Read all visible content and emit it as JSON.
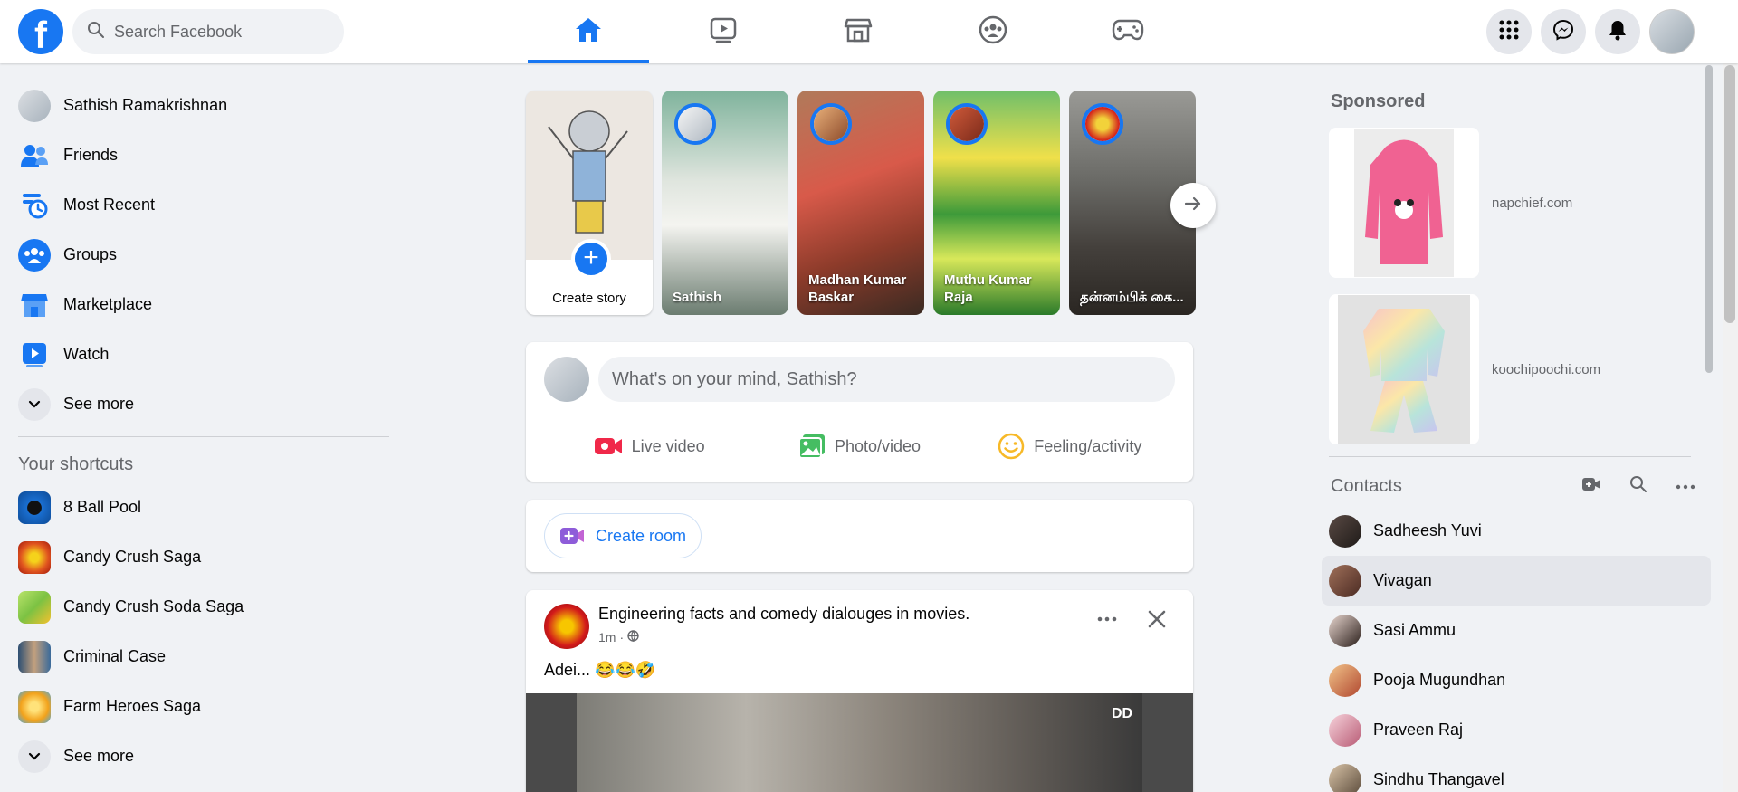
{
  "topbar": {
    "logo_text": "f",
    "search_placeholder": "Search Facebook",
    "tabs": [
      {
        "name": "home",
        "icon": "home-icon",
        "active": true
      },
      {
        "name": "watch",
        "icon": "video-icon",
        "active": false
      },
      {
        "name": "marketplace",
        "icon": "store-icon",
        "active": false
      },
      {
        "name": "groups",
        "icon": "groups-icon",
        "active": false
      },
      {
        "name": "gaming",
        "icon": "gamepad-icon",
        "active": false
      }
    ],
    "accent_color": "#1877f2"
  },
  "leftnav": {
    "items": [
      {
        "label": "Sathish Ramakrishnan",
        "icon": "avatar"
      },
      {
        "label": "Friends",
        "icon": "friends-icon"
      },
      {
        "label": "Most Recent",
        "icon": "clock-feed-icon"
      },
      {
        "label": "Groups",
        "icon": "groups-icon"
      },
      {
        "label": "Marketplace",
        "icon": "store-icon"
      },
      {
        "label": "Watch",
        "icon": "watch-icon"
      },
      {
        "label": "See more",
        "icon": "chevron-down-icon"
      }
    ],
    "shortcuts_title": "Your shortcuts",
    "shortcuts": [
      {
        "label": "8 Ball Pool",
        "color": "#1a6fd1"
      },
      {
        "label": "Candy Crush Saga",
        "color": "#e0541f"
      },
      {
        "label": "Candy Crush Soda Saga",
        "color": "#7cc243"
      },
      {
        "label": "Criminal Case",
        "color": "#3a6a9a"
      },
      {
        "label": "Farm Heroes Saga",
        "color": "#f2a21b"
      }
    ],
    "shortcuts_see_more": "See more"
  },
  "stories": {
    "create_label": "Create story",
    "items": [
      {
        "name": "Sathish"
      },
      {
        "name": "Madhan Kumar Baskar"
      },
      {
        "name": "Muthu Kumar Raja"
      },
      {
        "name": "தன்னம்பிக் கை..."
      }
    ]
  },
  "composer": {
    "placeholder": "What's on your mind, Sathish?",
    "live_label": "Live video",
    "photo_label": "Photo/video",
    "feeling_label": "Feeling/activity"
  },
  "room": {
    "label": "Create room"
  },
  "post": {
    "author": "Engineering facts and comedy dialouges in movies.",
    "time": "1m",
    "text": "Adei... 😂😂🤣",
    "media_badge": "DD"
  },
  "sponsored": {
    "title": "Sponsored",
    "items": [
      {
        "domain": "napchief.com"
      },
      {
        "domain": "koochipoochi.com"
      }
    ]
  },
  "contacts": {
    "title": "Contacts",
    "items": [
      {
        "name": "Sadheesh Yuvi"
      },
      {
        "name": "Vivagan"
      },
      {
        "name": "Sasi Ammu"
      },
      {
        "name": "Pooja Mugundhan"
      },
      {
        "name": "Praveen Raj"
      },
      {
        "name": "Sindhu Thangavel"
      }
    ]
  }
}
